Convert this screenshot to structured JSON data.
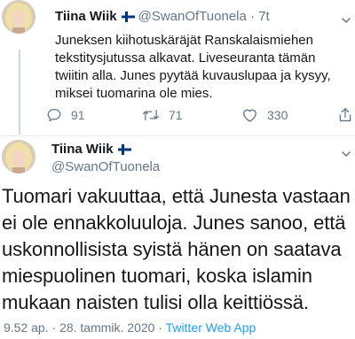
{
  "tweet1": {
    "author_name": "Tiina Wiik",
    "handle": "@SwanOfTuonela",
    "separator": "·",
    "time": "7t",
    "text": "Juneksen kiihotuskäräjät Ranskalaismiehen tekstitysjutussa alkavat. Liveseuranta tämän twiitin alla. Junes pyytää kuvauslupaa ja kysyy, miksei tuomarina ole mies.",
    "replies": "91",
    "retweets": "71",
    "likes": "330"
  },
  "tweet2": {
    "author_name": "Tiina Wiik",
    "handle": "@SwanOfTuonela",
    "text": "Tuomari vakuuttaa, että Junesta vastaan ei ole ennakkoluuloja. Junes sanoo, että uskonnollisista syistä hänen on saatava miespuolinen tuomari, koska islamin mukaan naisten tulisi olla keittiössä.",
    "time": "9.52 ap.",
    "separator": "·",
    "date": "28. tammik. 2020",
    "app": "Twitter Web App"
  },
  "colors": {
    "link": "#1da1f2",
    "secondary_text": "#657786",
    "primary_text": "#14171a",
    "flag_blue": "#003580"
  },
  "icons": {
    "reply": "reply-icon",
    "retweet": "retweet-icon",
    "like": "heart-icon",
    "share": "share-icon",
    "more": "chevron-down-icon",
    "flag": "finland-flag-icon"
  }
}
